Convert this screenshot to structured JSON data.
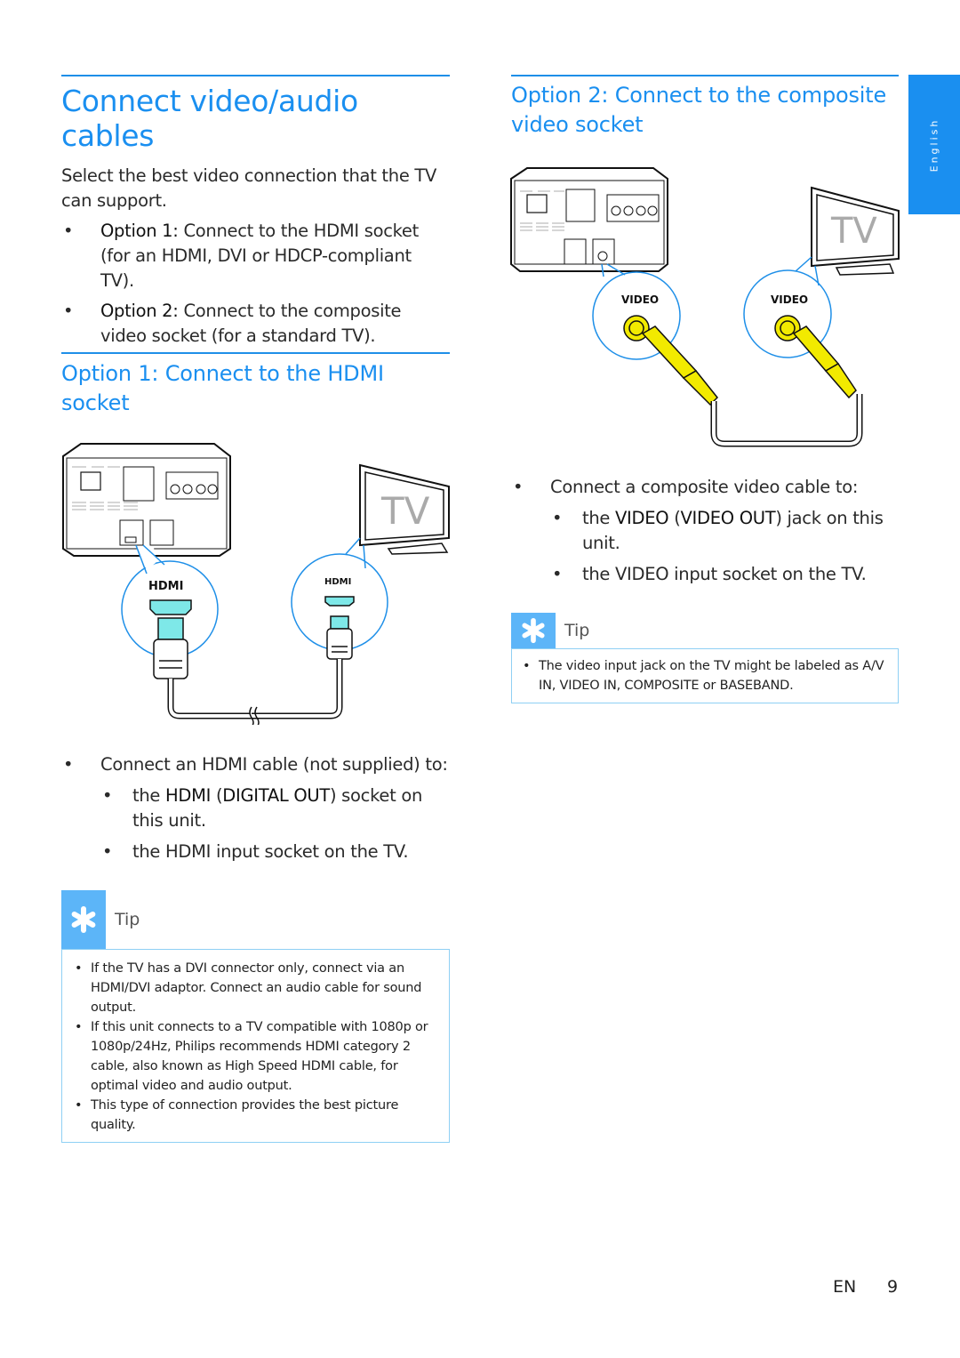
{
  "page": {
    "language_tab": "English",
    "footer": {
      "lang": "EN",
      "page_number": "9"
    }
  },
  "left": {
    "title": "Connect video/audio cables",
    "intro": "Select the best video connection that the TV can support.",
    "options": [
      {
        "label": "Option 1:",
        "text": " Connect to the HDMI socket (for an HDMI, DVI or HDCP-compliant TV)."
      },
      {
        "label": "Option 2:",
        "text": " Connect to the composite video socket (for a standard TV)."
      }
    ],
    "section_title": "Option 1: Connect to the HDMI socket",
    "diagram": {
      "tv_text": "TV",
      "unit_port_label": "HDMI",
      "tv_port_label": "HDMI",
      "connector_color": "#7ee8e8"
    },
    "instruction": "Connect an HDMI cable (not supplied) to:",
    "steps": [
      {
        "pre": "the ",
        "b1": "HDMI",
        "mid": " (",
        "b2": "DIGITAL OUT",
        "post": ") socket on this unit."
      },
      {
        "pre": "the HDMI input socket on the TV.",
        "b1": "",
        "mid": "",
        "b2": "",
        "post": ""
      }
    ],
    "tip": {
      "label": "Tip",
      "items": [
        "If the TV has a DVI connector only, connect via an HDMI/DVI adaptor. Connect an audio cable for sound output.",
        "If this unit connects to a TV compatible with 1080p or 1080p/24Hz, Philips recommends HDMI category 2 cable, also known as High Speed HDMI cable, for optimal video and audio output.",
        "This type of connection provides the best picture quality."
      ]
    }
  },
  "right": {
    "section_title": "Option 2: Connect to the composite video socket",
    "diagram": {
      "tv_text": "TV",
      "unit_port_label": "VIDEO",
      "tv_port_label": "VIDEO",
      "connector_color": "#f2ea00"
    },
    "instruction": "Connect a composite video cable to:",
    "steps": [
      {
        "pre": "the ",
        "b1": "VIDEO",
        "mid": " (",
        "b2": "VIDEO OUT",
        "post": ") jack on this unit."
      },
      {
        "pre": "the VIDEO input socket on the TV.",
        "b1": "",
        "mid": "",
        "b2": "",
        "post": ""
      }
    ],
    "tip": {
      "label": "Tip",
      "items": [
        "The video input jack on the TV might be labeled as A/V IN, VIDEO IN, COMPOSITE or BASEBAND."
      ]
    }
  },
  "colors": {
    "accent": "#1a8ff0",
    "tip_icon": "#5cb5f8",
    "tip_border": "#8fd0f4"
  }
}
